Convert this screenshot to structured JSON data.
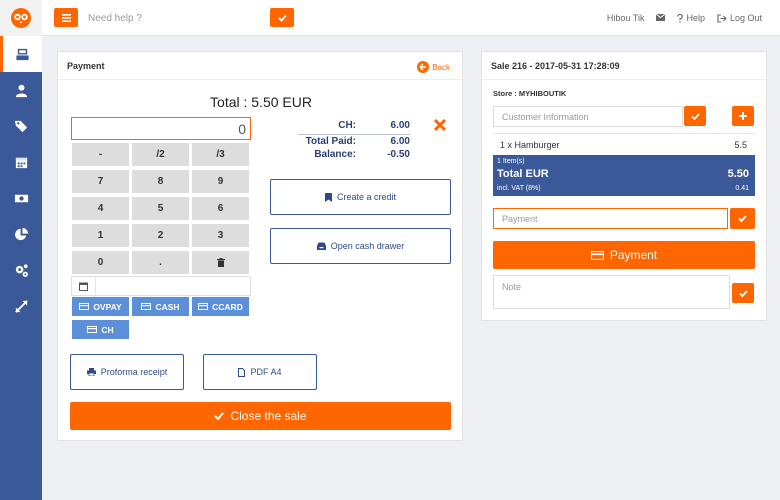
{
  "colors": {
    "accent": "#ff6600",
    "brand": "#3b5998",
    "pay_button": "#5b8fd8"
  },
  "topbar": {
    "menu_icon": "bars-icon",
    "help_placeholder": "Need help ?",
    "help_submit_icon": "check-icon",
    "user_name": "Hibou Tik",
    "mail_icon": "envelope-icon",
    "help_label": "Help",
    "logout_label": "Log Out"
  },
  "sidebar": {
    "logo_icon": "owl-logo-icon",
    "items": [
      {
        "icon": "register-icon",
        "active": true
      },
      {
        "icon": "user-icon"
      },
      {
        "icon": "tags-icon"
      },
      {
        "icon": "calendar-icon"
      },
      {
        "icon": "money-icon"
      },
      {
        "icon": "pie-chart-icon"
      },
      {
        "icon": "cogs-icon"
      },
      {
        "icon": "expand-icon"
      }
    ]
  },
  "payment_panel": {
    "title": "Payment",
    "back_label": "Back",
    "total_title": "Total : 5.50 EUR",
    "amount_value": "0",
    "keypad": [
      "-",
      "/2",
      "/3",
      "7",
      "8",
      "9",
      "4",
      "5",
      "6",
      "1",
      "2",
      "3",
      "0",
      ".",
      "trash-icon"
    ],
    "payment_methods": [
      "OVPAY",
      "CASH",
      "CCARD",
      "CH"
    ],
    "summary": [
      {
        "label": "CH:",
        "value": "6.00"
      },
      {
        "label": "Total Paid:",
        "value": "6.00"
      },
      {
        "label": "Balance:",
        "value": "-0.50"
      }
    ],
    "create_credit_label": "Create a credit",
    "open_drawer_label": "Open cash drawer",
    "proforma_label": "Proforma receipt",
    "pdf_label": "PDF A4",
    "close_sale_label": "Close the sale"
  },
  "sale_panel": {
    "title": "Sale 216 - 2017-05-31 17:28:09",
    "store_label": "Store : MYHIBOUTIK",
    "customer_placeholder": "Customer Information",
    "line_item": {
      "label": "1 x Hamburger",
      "value": "5.5"
    },
    "total_box": {
      "items_count": "1 Item(s)",
      "total_label": "Total EUR",
      "total_value": "5.50",
      "vat_label": "incl. VAT (8%)",
      "vat_value": "0.41"
    },
    "payment_placeholder": "Payment",
    "payment_button": "Payment",
    "note_placeholder": "Note"
  }
}
